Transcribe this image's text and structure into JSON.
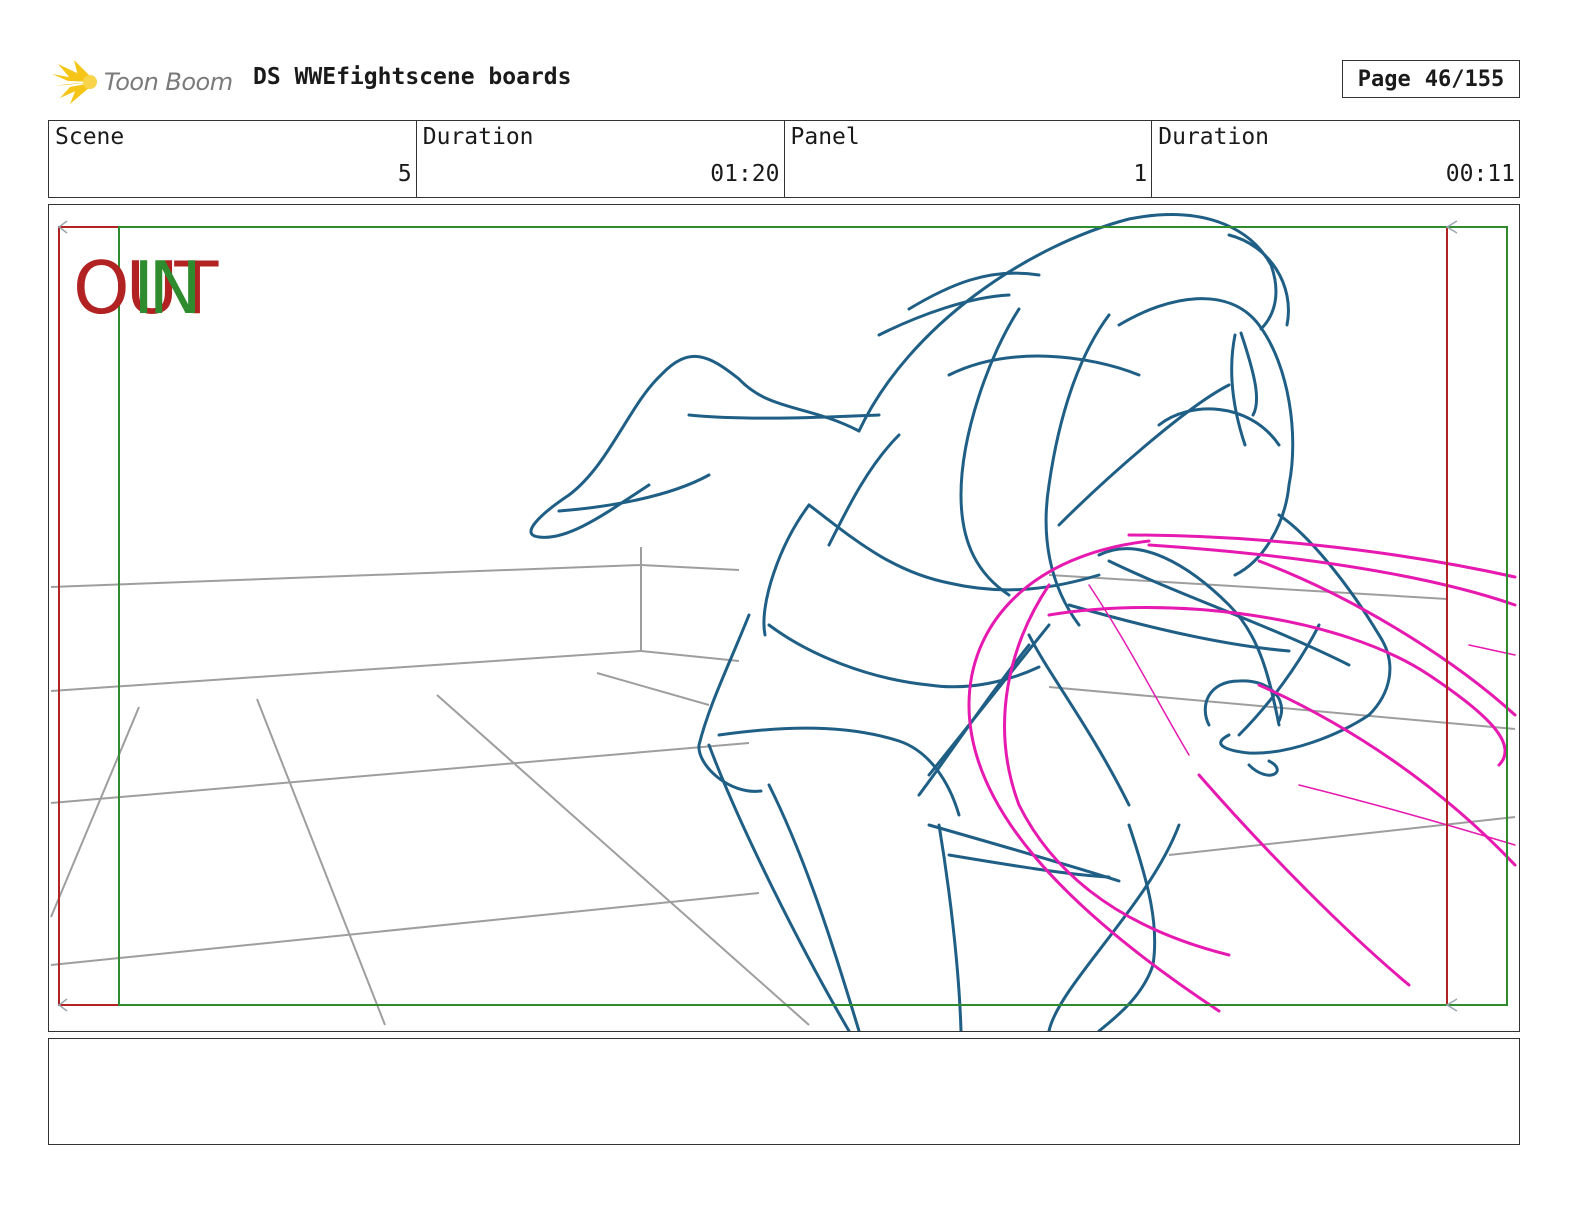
{
  "header": {
    "logo_text": "Toon Boom",
    "title": "DS WWEfightscene boards",
    "page_label": "Page",
    "page_number": "46/155"
  },
  "info": [
    {
      "label": "Scene",
      "value": "5"
    },
    {
      "label": "Duration",
      "value": "01:20"
    },
    {
      "label": "Panel",
      "value": "1"
    },
    {
      "label": "Duration",
      "value": "00:11"
    }
  ],
  "panel": {
    "out_label": "OUT",
    "in_label": "IN",
    "colors": {
      "frame_out": "#b22222",
      "frame_in": "#2e8b2e",
      "sketch": "#1f5f86",
      "motion": "#e619b0",
      "set": "#9e9e9e"
    }
  },
  "notes": {}
}
